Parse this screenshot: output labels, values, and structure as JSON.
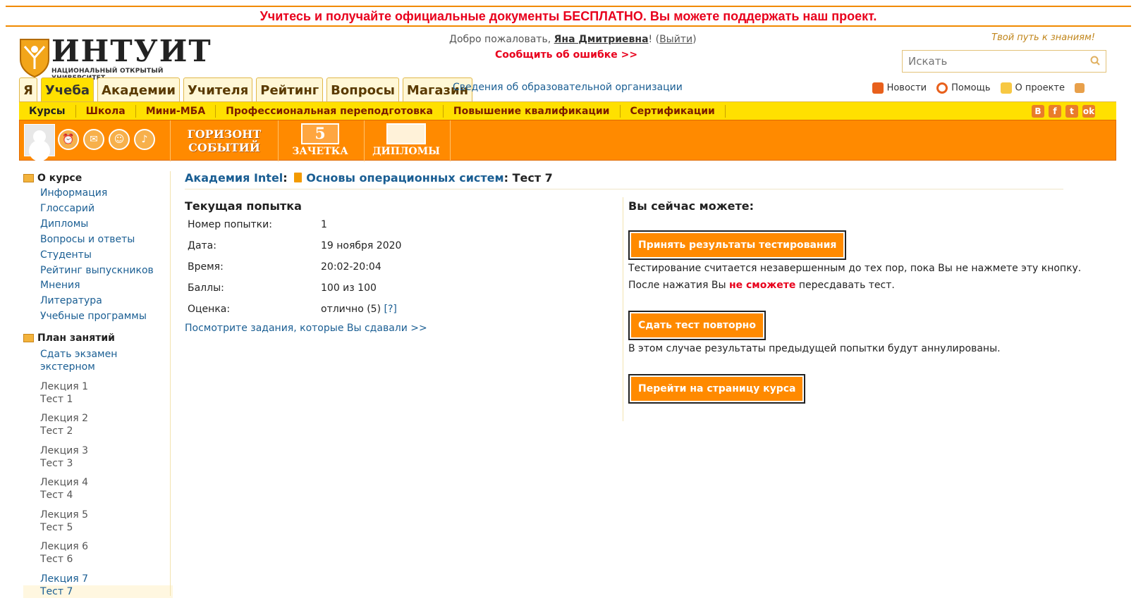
{
  "promo": "Учитесь и получайте официальные документы БЕСПЛАТНО. Вы можете поддержать наш проект.",
  "header": {
    "logo_text": "ИНТУИТ",
    "logo_sub": "НАЦИОНАЛЬНЫЙ ОТКРЫТЫЙ УНИВЕРСИТЕТ",
    "welcome_prefix": "Добро пожаловать, ",
    "user_name": "Яна Дмитриевна",
    "welcome_bang": "! (",
    "logout": "Выйти",
    "welcome_close": ")",
    "report_error": "Сообщить об ошибке >>",
    "motto": "Твой путь к знаниям!",
    "search_placeholder": "Искать",
    "org_info": "Сведения об образовательной организации",
    "top_links": {
      "news": "Новости",
      "help": "Помощь",
      "about": "О проекте"
    }
  },
  "tabs": [
    "Я",
    "Учеба",
    "Академии",
    "Учителя",
    "Рейтинг",
    "Вопросы",
    "Магазин"
  ],
  "subnav": [
    "Курсы",
    "Школа",
    "Мини-МБА",
    "Профессиональная переподготовка",
    "Повышение квалификации",
    "Сертификации"
  ],
  "social": [
    "B",
    "f",
    "t",
    "ok"
  ],
  "strip": {
    "horizon_line1": "ГОРИЗОНТ",
    "horizon_line2": "СОБЫТИЙ",
    "zachetka_num": "5",
    "zachetka": "ЗАЧЕТКА",
    "diplomy": "ДИПЛОМЫ"
  },
  "sidebar": {
    "about_title": "О курсе",
    "about_links": [
      "Информация",
      "Глоссарий",
      "Дипломы",
      "Вопросы и ответы",
      "Студенты",
      "Рейтинг выпускников",
      "Мнения",
      "Литература",
      "Учебные программы"
    ],
    "plan_title": "План занятий",
    "exam_line1": "Сдать экзамен",
    "exam_line2": "экстерном",
    "lessons": [
      {
        "lecture": "Лекция 1",
        "test": "Тест 1"
      },
      {
        "lecture": "Лекция 2",
        "test": "Тест 2"
      },
      {
        "lecture": "Лекция 3",
        "test": "Тест 3"
      },
      {
        "lecture": "Лекция 4",
        "test": "Тест 4"
      },
      {
        "lecture": "Лекция 5",
        "test": "Тест 5"
      },
      {
        "lecture": "Лекция 6",
        "test": "Тест 6"
      },
      {
        "lecture": "Лекция 7",
        "test": "Тест 7"
      }
    ]
  },
  "breadcrumb": {
    "academy": "Академия Intel",
    "sep": ": ",
    "course": "Основы операционных систем",
    "current": ": Тест 7"
  },
  "attempt": {
    "title": "Текущая попытка",
    "rows": [
      {
        "key": "Номер попытки:",
        "value": "1"
      },
      {
        "key": "Дата:",
        "value": "19 ноября 2020"
      },
      {
        "key": "Время:",
        "value": "20:02-20:04"
      },
      {
        "key": "Баллы:",
        "value": "100 из 100"
      },
      {
        "key": "Оценка:",
        "value": "отлично (5)"
      }
    ],
    "grade_help": "[?]",
    "view_tasks": "Посмотрите задания, которые Вы сдавали >>"
  },
  "actions": {
    "title": "Вы сейчас можете:",
    "accept_button": "Принять результаты тестирования",
    "accept_note1": "Тестирование считается незавершенным до тех пор, пока Вы не нажмете эту кнопку.",
    "accept_note2_a": "После нажатия Вы ",
    "accept_note2_red": "не сможете",
    "accept_note2_b": " пересдавать тест.",
    "retake_button": "Сдать тест повторно",
    "retake_note": "В этом случае результаты предыдущей попытки будут аннулированы.",
    "course_button": "Перейти на страницу курса"
  }
}
